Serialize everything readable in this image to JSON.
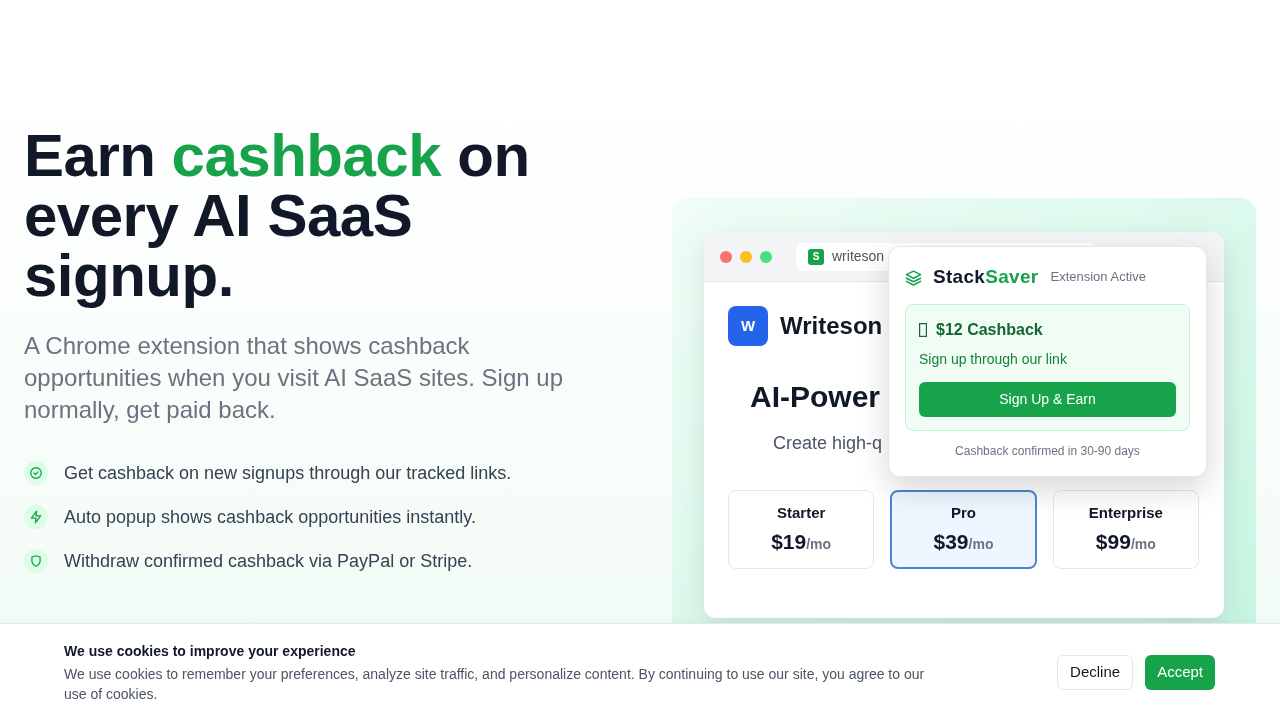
{
  "hero": {
    "headline": [
      {
        "text": "Earn ",
        "accent": false
      },
      {
        "text": "cashback",
        "accent": true
      },
      {
        "text": " on every AI SaaS signup.",
        "accent": false
      }
    ],
    "subtitle": "A Chrome extension that shows cashback opportunities when you visit AI SaaS sites. Sign up normally, get paid back.",
    "features": [
      {
        "kind": "check",
        "text": "Get cashback on new signups through our tracked links."
      },
      {
        "kind": "bolt",
        "text": "Auto popup shows cashback opportunities instantly."
      },
      {
        "kind": "shield",
        "text": "Withdraw confirmed cashback via PayPal or Stripe."
      }
    ]
  },
  "preview": {
    "browser": {
      "favicon": "S",
      "address": "writeson"
    },
    "site": {
      "logo": "W",
      "name": "Writeson",
      "heading": "AI-Power",
      "tagline": "Create high-q",
      "plans": [
        {
          "name": "Starter",
          "price": "$19",
          "period": "/mo",
          "selected": false
        },
        {
          "name": "Pro",
          "price": "$39",
          "period": "/mo",
          "selected": true
        },
        {
          "name": "Enterprise",
          "price": "$99",
          "period": "/mo",
          "selected": false
        }
      ]
    },
    "popup": {
      "brand": [
        {
          "text": "Stack",
          "accent": false
        },
        {
          "text": "Saver",
          "accent": true
        }
      ],
      "status": "Extension Active",
      "offer": {
        "title": "$12 Cashback",
        "note": "Sign up through our link",
        "button": "Sign Up & Earn"
      },
      "footer": "Cashback confirmed in 30-90 days"
    }
  },
  "cookie_banner": {
    "title": "We use cookies to improve your experience",
    "text": "We use cookies to remember your preferences, analyze site traffic, and personalize content. By continuing to use our site, you agree to our use of cookies.",
    "buttons": [
      {
        "label": "Decline",
        "kind": "secondary"
      },
      {
        "label": "Accept",
        "kind": "primary"
      }
    ]
  }
}
